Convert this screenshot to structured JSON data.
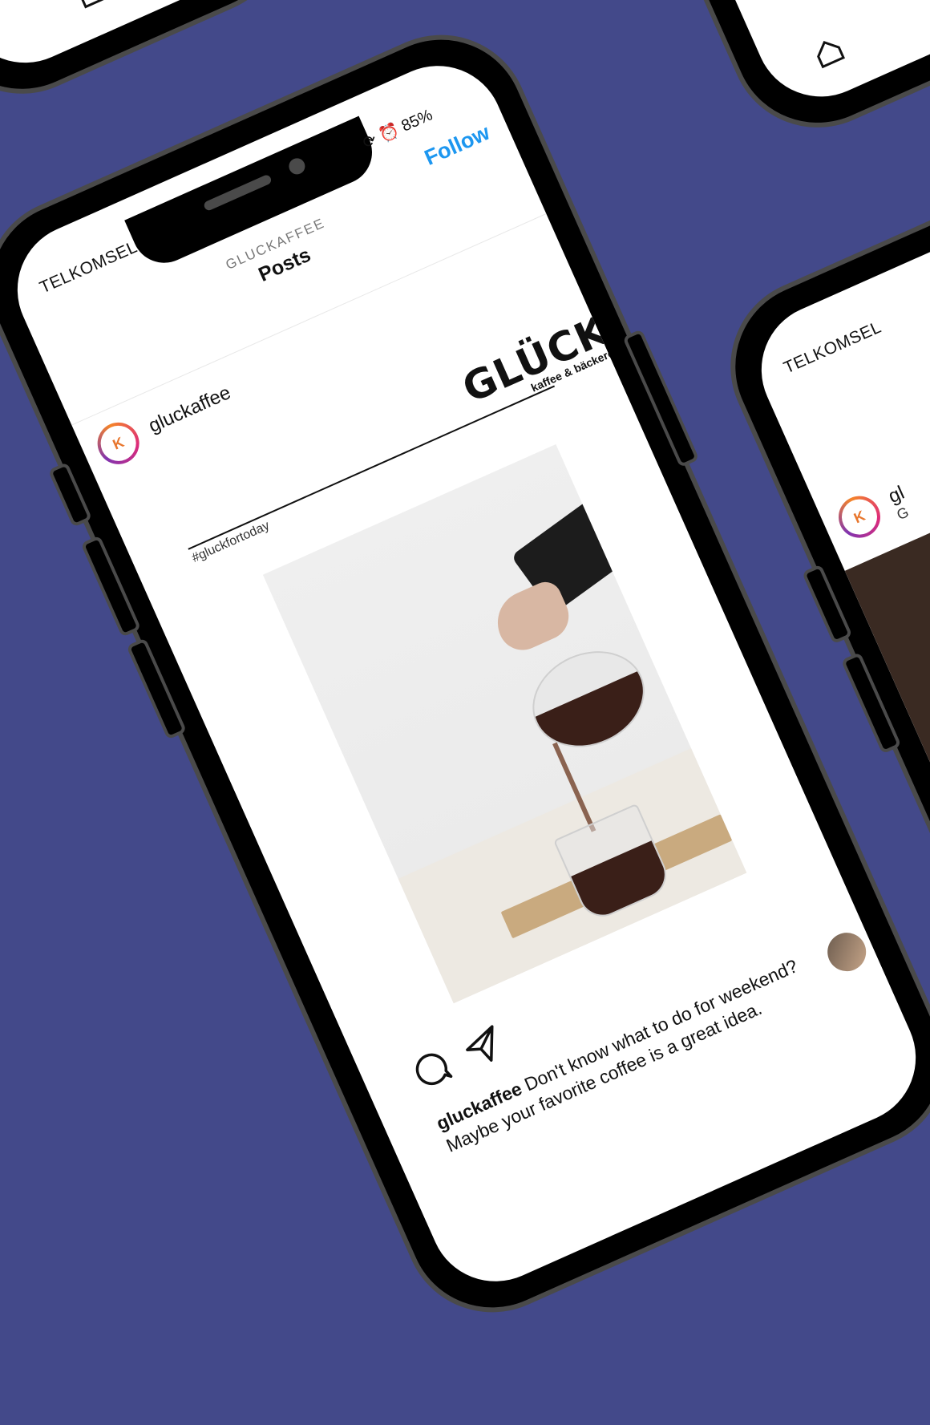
{
  "main_phone": {
    "status_bar": {
      "carrier": "TELKOMSEL",
      "battery": "85%"
    },
    "header": {
      "subtitle": "GLUCKAFFEE",
      "title": "Posts",
      "follow_label": "Follow"
    },
    "post": {
      "username": "gluckaffee",
      "avatar_letter": "K",
      "brand_name": "GLÜCK",
      "brand_tagline": "kaffee & bäckerei",
      "hashtag": "#gluckfortoday",
      "caption_user": "gluckaffee",
      "caption": "Don't know what to do for weekend? Maybe your favorite coffee is a great idea."
    }
  },
  "right_phone": {
    "status_bar": {
      "carrier": "TELKOMSEL"
    },
    "post": {
      "username_fragment": "gl",
      "subtitle_fragment": "G"
    }
  },
  "colors": {
    "background": "#43498a",
    "follow_blue": "#1d97f0",
    "bezel": "#000000",
    "frame": "#4a4a4a"
  },
  "icons": [
    "home-icon",
    "search-icon",
    "comment-icon",
    "send-icon",
    "alarm-icon",
    "rotation-lock-icon"
  ]
}
